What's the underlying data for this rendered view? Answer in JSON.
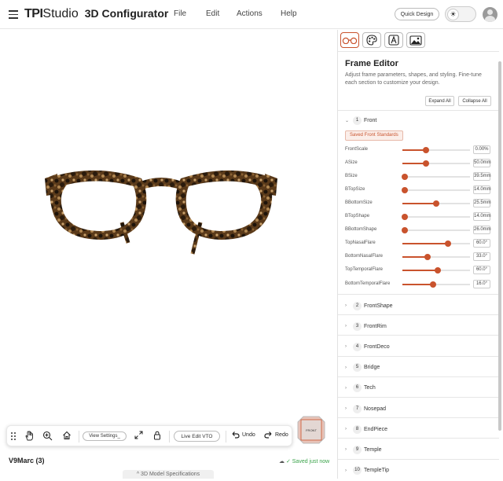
{
  "app": {
    "brand_bold": "TPI",
    "brand_light": "Studio",
    "title": "3D Configurator",
    "menu": [
      "File",
      "Edit",
      "Actions",
      "Help"
    ],
    "quick_design": "Quick Design"
  },
  "viewport": {
    "viewcube_label": "FRONT",
    "toolbar": {
      "view_settings": "View Settings_",
      "live_edit": "Live Edit VTO",
      "undo": "Undo",
      "redo": "Redo"
    },
    "model_name": "V9Marc (3)",
    "saved": "✓ Saved just now",
    "spec_tab": "^ 3D Model Specifications"
  },
  "panel": {
    "title": "Frame Editor",
    "subtitle": "Adjust frame parameters, shapes, and styling. Fine-tune each section to customize your design.",
    "expand_all": "Expand All",
    "collapse_all": "Collapse All",
    "front_section": {
      "number": "1",
      "label": "Front",
      "saved_standards": "Saved Front Standards"
    },
    "params": [
      {
        "label": "FrontScale",
        "value": "0.00%",
        "level": 0.35
      },
      {
        "label": "ASize",
        "value": "50.0mm",
        "level": 0.35
      },
      {
        "label": "BSize",
        "value": "39.5mm",
        "level": 0.03
      },
      {
        "label": "BTopSize",
        "value": "14.0mm",
        "level": 0.03
      },
      {
        "label": "BBottomSize",
        "value": "25.5mm",
        "level": 0.5
      },
      {
        "label": "BTopShape",
        "value": "14.0mm",
        "level": 0.03
      },
      {
        "label": "BBottomShape",
        "value": "26.0mm",
        "level": 0.03
      },
      {
        "label": "TopNasalFlare",
        "value": "60.0°",
        "level": 0.67
      },
      {
        "label": "BottomNasalFlare",
        "value": "33.0°",
        "level": 0.37
      },
      {
        "label": "TopTemporalFlare",
        "value": "60.0°",
        "level": 0.52
      },
      {
        "label": "BottomTemporalFlare",
        "value": "16.0°",
        "level": 0.45
      }
    ],
    "sections": [
      {
        "number": "2",
        "label": "FrontShape"
      },
      {
        "number": "3",
        "label": "FrontRim"
      },
      {
        "number": "4",
        "label": "FrontDeco"
      },
      {
        "number": "5",
        "label": "Bridge"
      },
      {
        "number": "6",
        "label": "Tech"
      },
      {
        "number": "7",
        "label": "Nosepad"
      },
      {
        "number": "8",
        "label": "EndPiece"
      },
      {
        "number": "9",
        "label": "Temple"
      },
      {
        "number": "10",
        "label": "TempleTip"
      }
    ]
  }
}
